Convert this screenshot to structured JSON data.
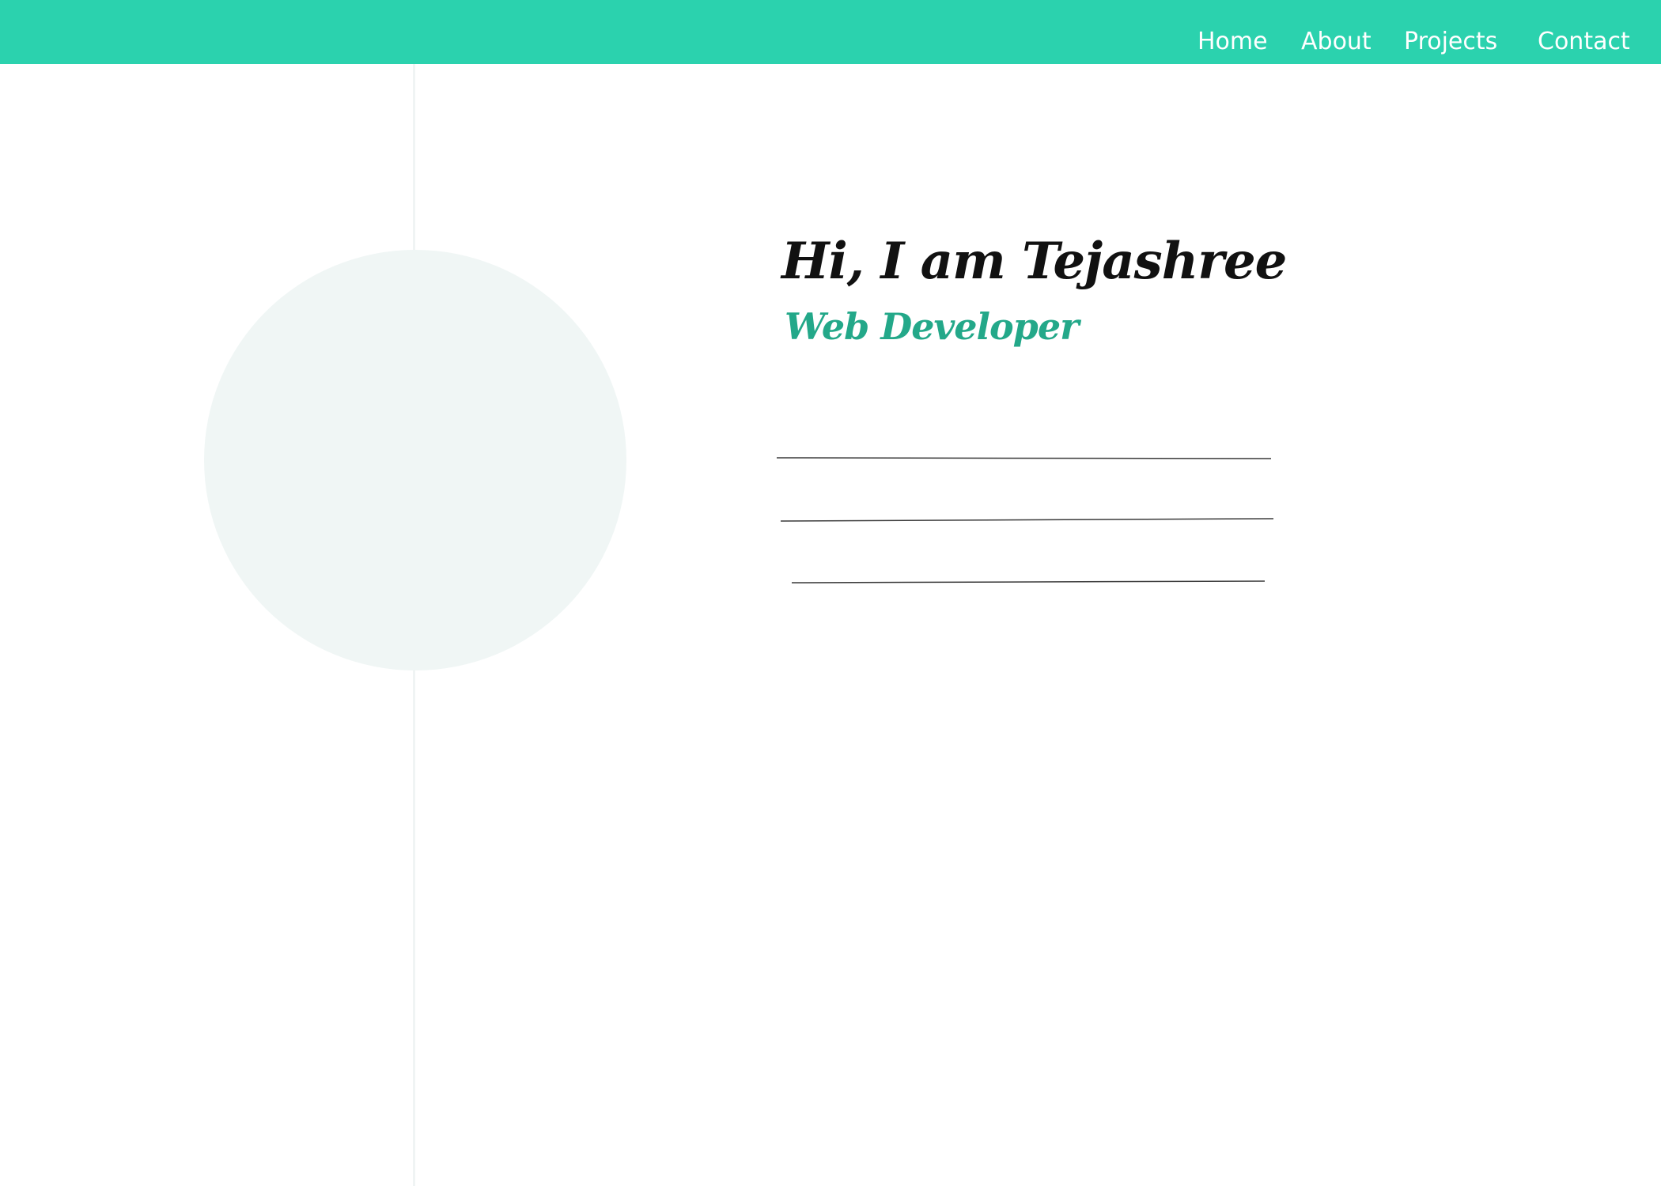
{
  "nav": {
    "items": [
      {
        "label": "Home"
      },
      {
        "label": "About"
      },
      {
        "label": "Projects"
      },
      {
        "label": "Contact"
      }
    ]
  },
  "hero": {
    "greeting": "Hi, I am Tejashree",
    "role": "Web Developer"
  },
  "colors": {
    "accent": "#2bd2ae",
    "role_text": "#23a889",
    "circle": "#f0f6f5",
    "timeline": "#f0f4f4"
  }
}
